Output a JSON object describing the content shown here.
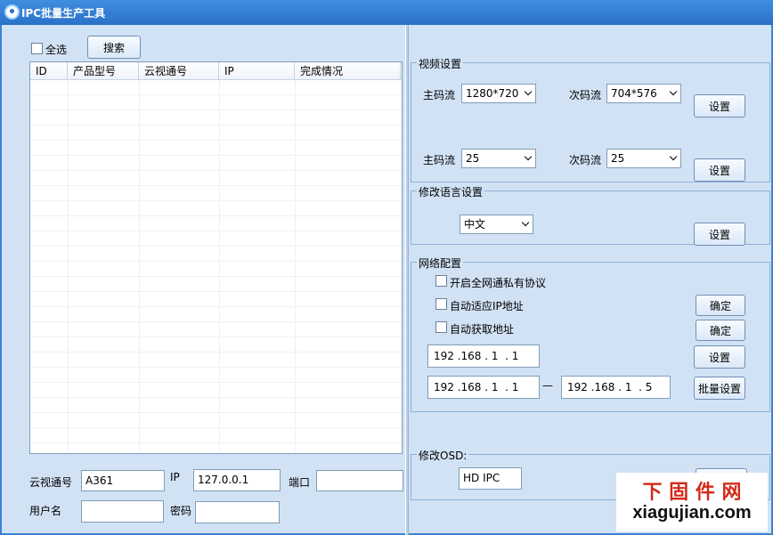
{
  "window": {
    "title": "IPC批量生产工具"
  },
  "left": {
    "select_all_label": "全选",
    "search_button": "搜索",
    "columns": [
      "ID",
      "产品型号",
      "云视通号",
      "IP",
      "完成情况"
    ],
    "form": {
      "cloud_id_label": "云视通号",
      "cloud_id_value": "A361",
      "ip_label": "IP",
      "ip_value": "127.0.0.1",
      "port_label": "端口",
      "port_value": "",
      "username_label": "用户名",
      "username_value": "",
      "password_label": "密码",
      "password_value": ""
    }
  },
  "video": {
    "title": "视频设置",
    "main_stream_label": "主码流",
    "sub_stream_label": "次码流",
    "main_resolution": "1280*720",
    "sub_resolution": "704*576",
    "main_fps": "25",
    "sub_fps": "25",
    "set_button": "设置"
  },
  "language": {
    "title": "修改语言设置",
    "value": "中文",
    "set_button": "设置"
  },
  "network": {
    "title": "网络配置",
    "opt_private_protocol": "开启全网通私有协议",
    "opt_auto_ip": "自动适应IP地址",
    "opt_auto_obtain": "自动获取地址",
    "confirm_button": "确定",
    "ip_single": "192 .168 . 1  . 1",
    "ip_range_start": "192 .168 . 1  . 1",
    "range_dash": "—",
    "ip_range_end": "192 .168 . 1  . 5",
    "set_button": "设置",
    "batch_set_button": "批量设置"
  },
  "osd": {
    "title": "修改OSD:",
    "value": "HD IPC"
  },
  "watermark": {
    "line1": "下 固 件 网",
    "line2": "xiagujian.com"
  }
}
